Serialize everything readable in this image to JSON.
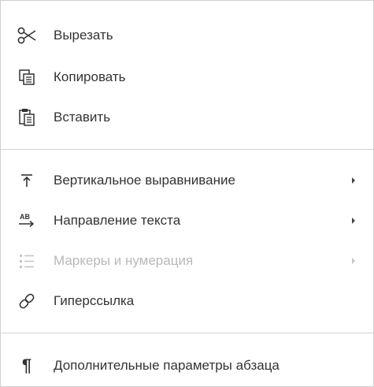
{
  "menu": {
    "items": [
      {
        "label": "Вырезать",
        "icon": "scissors-icon",
        "disabled": false,
        "submenu": false
      },
      {
        "label": "Копировать",
        "icon": "copy-icon",
        "disabled": false,
        "submenu": false
      },
      {
        "label": "Вставить",
        "icon": "paste-icon",
        "disabled": false,
        "submenu": false
      },
      {
        "label": "Вертикальное выравнивание",
        "icon": "vertical-align-top-icon",
        "disabled": false,
        "submenu": true
      },
      {
        "label": "Направление текста",
        "icon": "text-direction-icon",
        "disabled": false,
        "submenu": true
      },
      {
        "label": "Маркеры и нумерация",
        "icon": "bullets-list-icon",
        "disabled": true,
        "submenu": true
      },
      {
        "label": "Гиперссылка",
        "icon": "hyperlink-icon",
        "disabled": false,
        "submenu": false
      },
      {
        "label": "Дополнительные параметры абзаца",
        "icon": "pilcrow-icon",
        "disabled": false,
        "submenu": false
      }
    ],
    "icon_glyphs": {
      "direction_top": "AB",
      "pilcrow": "¶"
    },
    "colors": {
      "text": "#333333",
      "disabled_text": "#b8b8b8",
      "border": "#cfcfcf",
      "divider": "#d4d4d4"
    }
  }
}
